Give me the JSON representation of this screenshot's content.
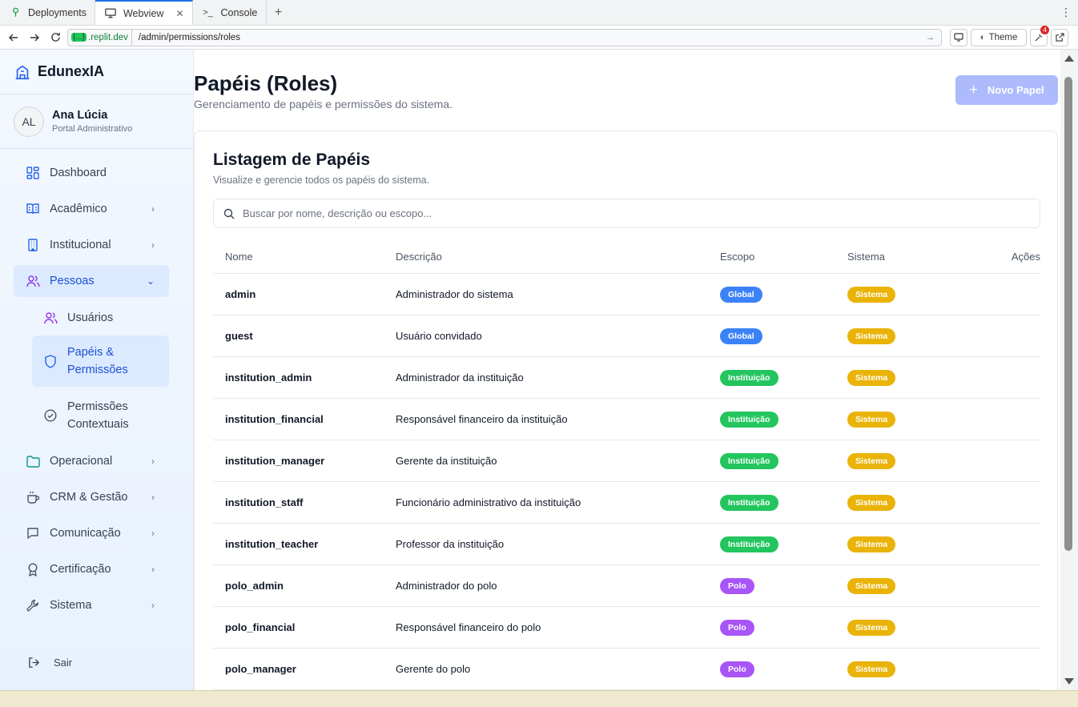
{
  "browser": {
    "tabs": [
      {
        "label": "Deployments",
        "icon": "deployments-icon"
      },
      {
        "label": "Webview",
        "icon": "monitor-icon"
      },
      {
        "label": "Console",
        "icon": "terminal-icon"
      }
    ],
    "domain": ".replit.dev",
    "domain_prefix": "{...}",
    "path": "/admin/permissions/roles",
    "theme_label": "Theme",
    "notification_count": "4"
  },
  "sidebar": {
    "brand": "EdunexIA",
    "user": {
      "initials": "AL",
      "name": "Ana Lúcia",
      "role": "Portal Administrativo"
    },
    "items": [
      {
        "label": "Dashboard",
        "icon": "dashboard-icon"
      },
      {
        "label": "Acadêmico",
        "icon": "book-icon"
      },
      {
        "label": "Institucional",
        "icon": "building-icon"
      },
      {
        "label": "Pessoas",
        "icon": "users-icon"
      },
      {
        "label": "Operacional",
        "icon": "folder-icon"
      },
      {
        "label": "CRM & Gestão",
        "icon": "coffee-icon"
      },
      {
        "label": "Comunicação",
        "icon": "message-icon"
      },
      {
        "label": "Certificação",
        "icon": "award-icon"
      },
      {
        "label": "Sistema",
        "icon": "wrench-icon"
      }
    ],
    "subitems": [
      {
        "label": "Usuários",
        "icon": "user-icon"
      },
      {
        "label_line1": "Papéis &",
        "label_line2": "Permissões",
        "icon": "shield-icon"
      },
      {
        "label_line1": "Permissões",
        "label_line2": "Contextuais",
        "icon": "check-circle-icon"
      }
    ],
    "logout": "Sair"
  },
  "main": {
    "title": "Papéis (Roles)",
    "subtitle": "Gerenciamento de papéis e permissões do sistema.",
    "new_button": "Novo Papel",
    "card": {
      "title": "Listagem de Papéis",
      "subtitle": "Visualize e gerencie todos os papéis do sistema.",
      "search_placeholder": "Buscar por nome, descrição ou escopo..."
    },
    "columns": [
      "Nome",
      "Descrição",
      "Escopo",
      "Sistema",
      "Ações"
    ],
    "rows": [
      {
        "name": "admin",
        "description": "Administrador do sistema",
        "scope": "Global",
        "system": "Sistema"
      },
      {
        "name": "guest",
        "description": "Usuário convidado",
        "scope": "Global",
        "system": "Sistema"
      },
      {
        "name": "institution_admin",
        "description": "Administrador da instituição",
        "scope": "Instituição",
        "system": "Sistema"
      },
      {
        "name": "institution_financial",
        "description": "Responsável financeiro da instituição",
        "scope": "Instituição",
        "system": "Sistema"
      },
      {
        "name": "institution_manager",
        "description": "Gerente da instituição",
        "scope": "Instituição",
        "system": "Sistema"
      },
      {
        "name": "institution_staff",
        "description": "Funcionário administrativo da instituição",
        "scope": "Instituição",
        "system": "Sistema"
      },
      {
        "name": "institution_teacher",
        "description": "Professor da instituição",
        "scope": "Instituição",
        "system": "Sistema"
      },
      {
        "name": "polo_admin",
        "description": "Administrador do polo",
        "scope": "Polo",
        "system": "Sistema"
      },
      {
        "name": "polo_financial",
        "description": "Responsável financeiro do polo",
        "scope": "Polo",
        "system": "Sistema"
      },
      {
        "name": "polo_manager",
        "description": "Gerente do polo",
        "scope": "Polo",
        "system": "Sistema"
      }
    ]
  },
  "colors": {
    "accent": "#1d4ed8",
    "scope_global": "#3b82f6",
    "scope_institution": "#22c55e",
    "scope_polo": "#a855f7",
    "system_badge": "#eab308",
    "new_button": "#a5b4fc"
  }
}
